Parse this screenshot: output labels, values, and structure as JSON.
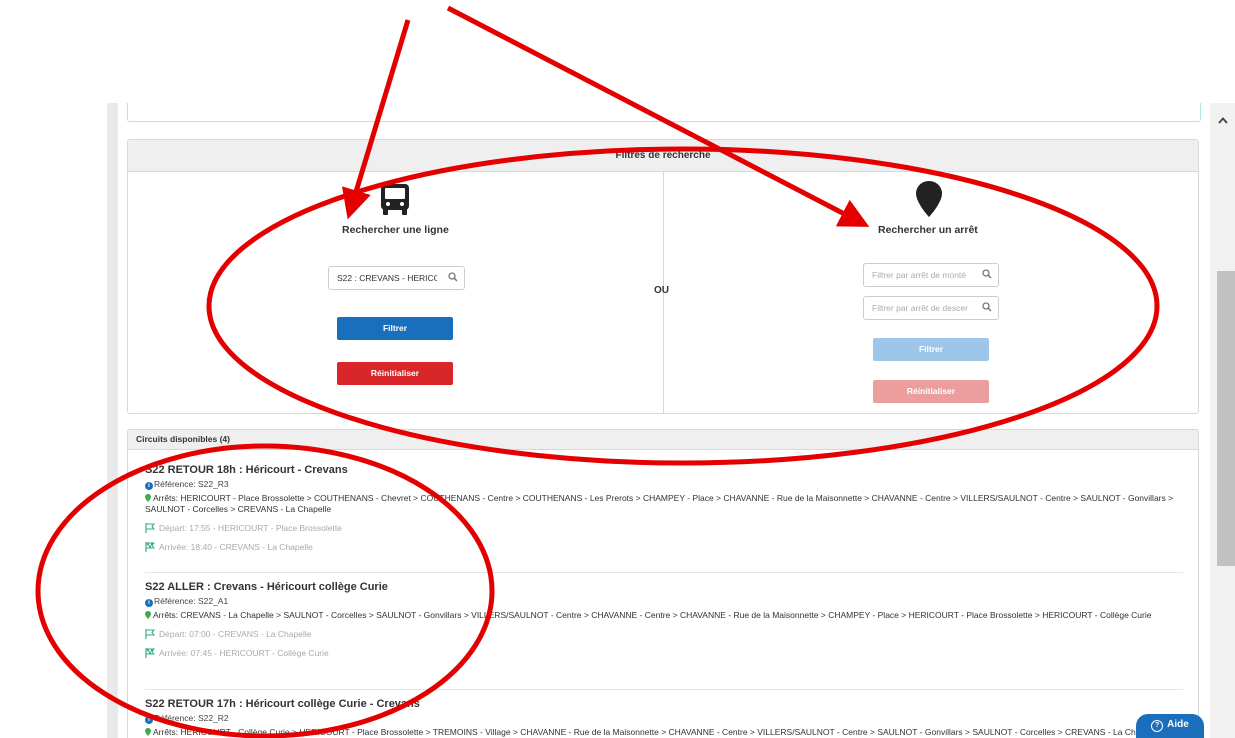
{
  "filters": {
    "title": "Filtres de recherche",
    "separator": "OU",
    "line": {
      "title": "Rechercher une ligne",
      "search_value": "S22 : CREVANS - HERICC",
      "filter_label": "Filtrer",
      "reset_label": "Réinitialiser"
    },
    "stop": {
      "title": "Rechercher un arrêt",
      "boarding_placeholder": "Filtrer par arrêt de monté",
      "alighting_placeholder": "Filtrer par arrêt de descer",
      "filter_label": "Filtrer",
      "reset_label": "Réinitialiser"
    }
  },
  "circuits": {
    "title": "Circuits disponibles (4)",
    "items": [
      {
        "title": "S22 RETOUR 18h : Héricourt - Crevans",
        "reference": "Référence: S22_R3",
        "stops": "Arrêts: HERICOURT - Place Brossolette > COUTHENANS - Chevret > COUTHENANS - Centre > COUTHENANS - Les Prerots > CHAMPEY - Place > CHAVANNE - Rue de la Maisonnette > CHAVANNE - Centre > VILLERS/SAULNOT - Centre > SAULNOT - Gonvillars > SAULNOT - Corcelles > CREVANS - La Chapelle",
        "departure": "Départ: 17:55 - HERICOURT - Place Brossolette",
        "arrival": "Arrivée: 18:40 - CREVANS - La Chapelle"
      },
      {
        "title": "S22 ALLER : Crevans - Héricourt collège Curie",
        "reference": "Référence: S22_A1",
        "stops": "Arrêts: CREVANS - La Chapelle > SAULNOT - Corcelles > SAULNOT - Gonvillars > VILLERS/SAULNOT - Centre > CHAVANNE - Centre > CHAVANNE - Rue de la Maisonnette > CHAMPEY - Place > HERICOURT - Place Brossolette > HERICOURT - Collège Curie",
        "departure": "Départ: 07:00 - CREVANS - La Chapelle",
        "arrival": "Arrivée: 07:45 - HERICOURT - Collège Curie"
      },
      {
        "title": "S22 RETOUR 17h : Héricourt collège Curie - Crevans",
        "reference": "Référence: S22_R2",
        "stops": "Arrêts: HERICOURT - Collège Curie > HERICOURT - Place Brossolette > TREMOINS - Village > CHAVANNE - Rue de la Maisonnette > CHAVANNE - Centre > VILLERS/SAULNOT - Centre > SAULNOT - Gonvillars > SAULNOT - Corcelles > CREVANS - La Chapelle"
      }
    ]
  },
  "help": {
    "label": "Aide",
    "icon": "question-circle-icon"
  },
  "icons": {
    "line": "bus-icon",
    "stop": "map-marker-icon",
    "search": "search-icon",
    "reference": "info-icon",
    "stops": "map-pin-icon",
    "departure": "flag-outline-icon",
    "arrival": "flag-checkered-icon"
  },
  "colors": {
    "primary": "#1a6fbd",
    "danger": "#d9262b",
    "annotation": "#e40000",
    "arrival_icon": "#3aaa8f",
    "stop_pin": "#3fae49"
  }
}
